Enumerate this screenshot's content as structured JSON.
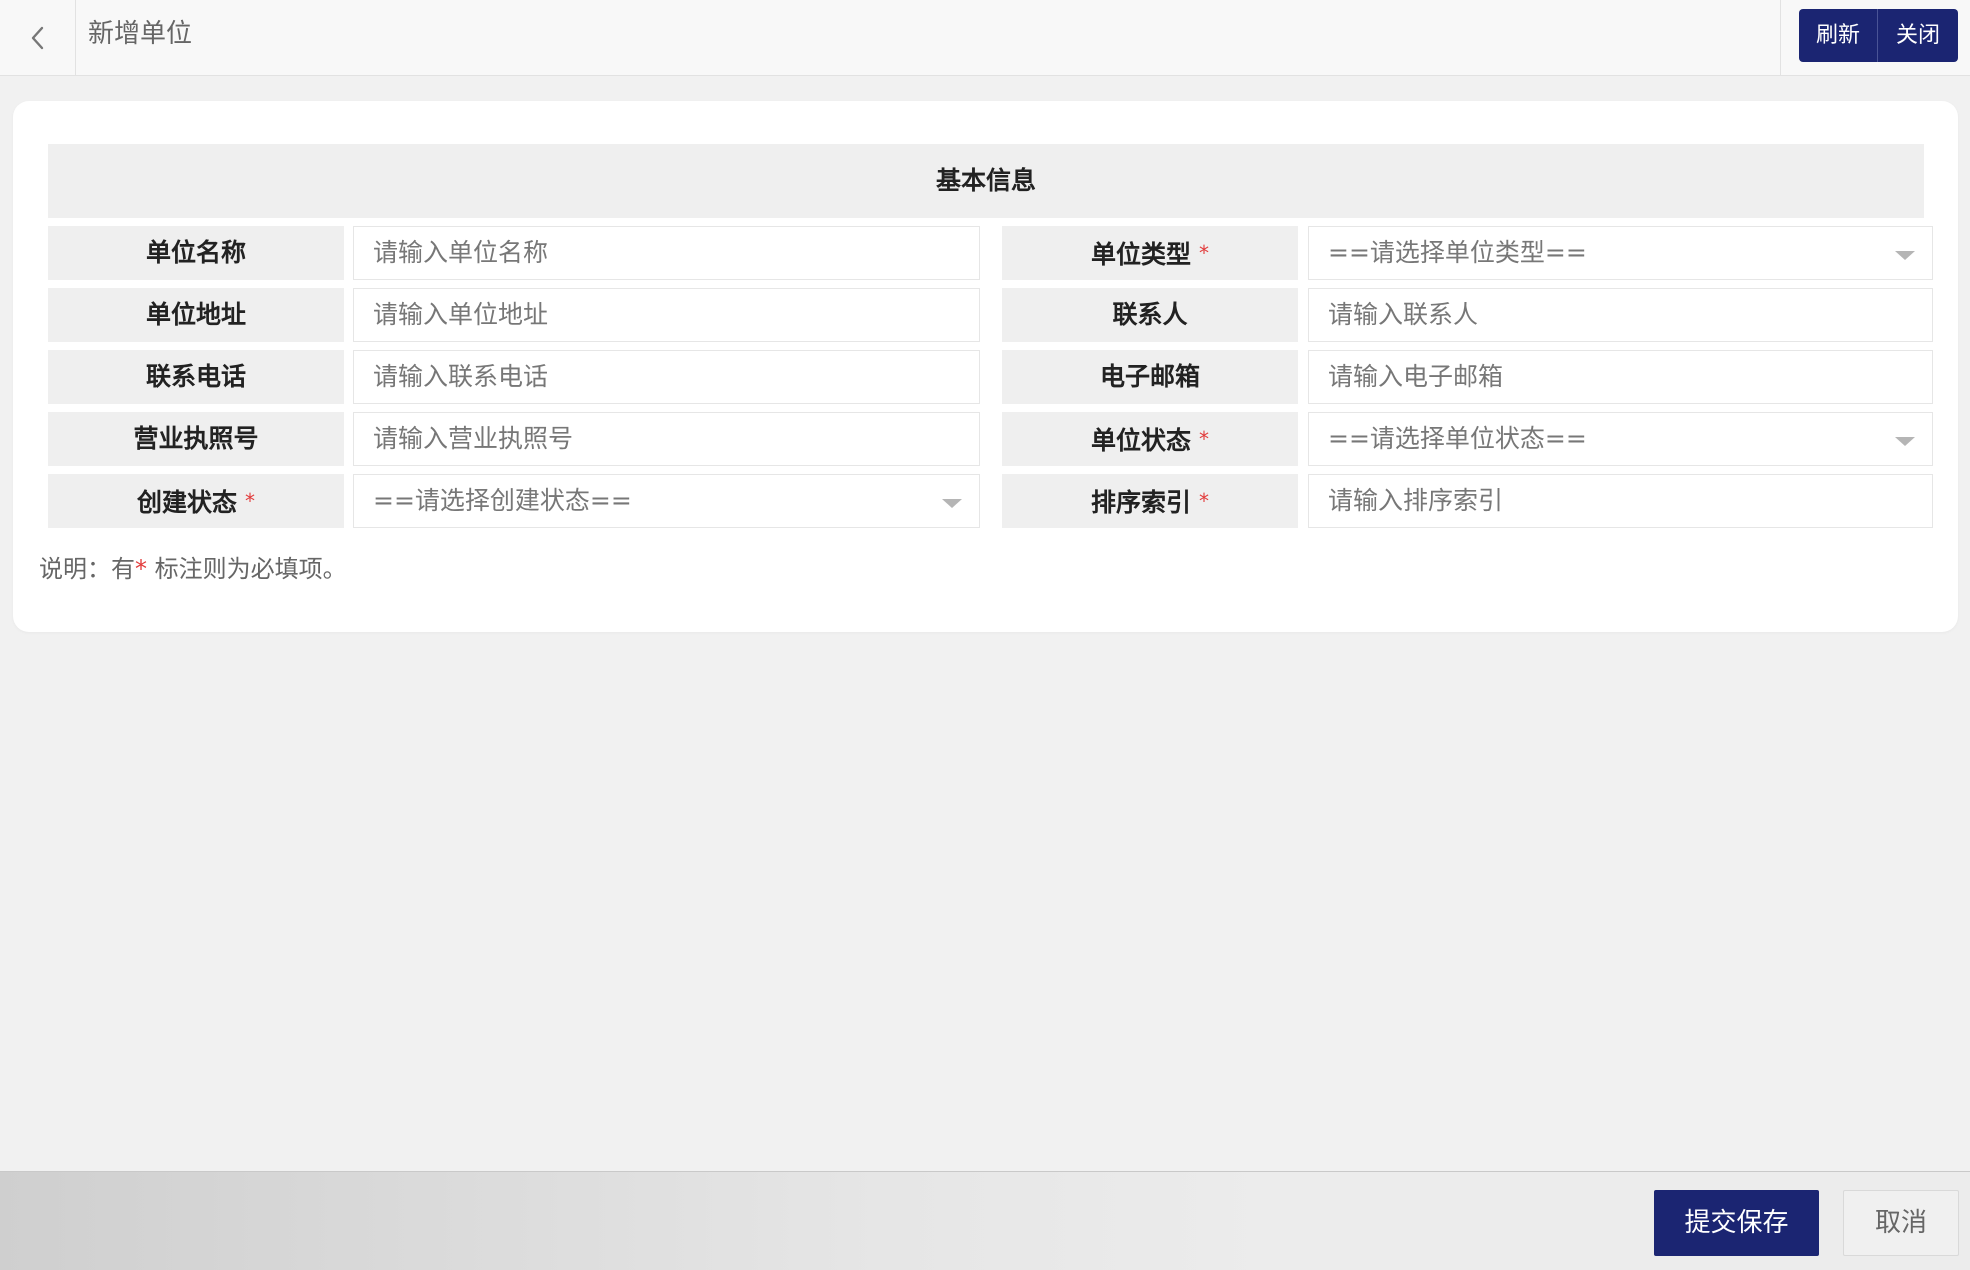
{
  "header": {
    "back_icon": "chevron-left-icon",
    "title": "新增单位",
    "refresh_label": "刷新",
    "close_label": "关闭"
  },
  "form": {
    "section_title": "基本信息",
    "required_mark": "*",
    "fields": {
      "unit_name": {
        "label": "单位名称",
        "placeholder": "请输入单位名称"
      },
      "unit_type": {
        "label": "单位类型",
        "selected": "==请选择单位类型==",
        "required": true
      },
      "unit_address": {
        "label": "单位地址",
        "placeholder": "请输入单位地址"
      },
      "contact_person": {
        "label": "联系人",
        "placeholder": "请输入联系人"
      },
      "contact_phone": {
        "label": "联系电话",
        "placeholder": "请输入联系电话"
      },
      "email": {
        "label": "电子邮箱",
        "placeholder": "请输入电子邮箱"
      },
      "business_license": {
        "label": "营业执照号",
        "placeholder": "请输入营业执照号"
      },
      "unit_status": {
        "label": "单位状态",
        "selected": "==请选择单位状态==",
        "required": true
      },
      "create_status": {
        "label": "创建状态",
        "selected": "==请选择创建状态==",
        "required": true
      },
      "sort_index": {
        "label": "排序索引",
        "placeholder": "请输入排序索引",
        "required": true
      }
    },
    "note_prefix": "说明：有",
    "note_suffix": " 标注则为必填项。"
  },
  "footer": {
    "submit_label": "提交保存",
    "cancel_label": "取消"
  },
  "colors": {
    "primary": "#1b2572",
    "required": "#e23b3b",
    "label_bg": "#efefef"
  }
}
